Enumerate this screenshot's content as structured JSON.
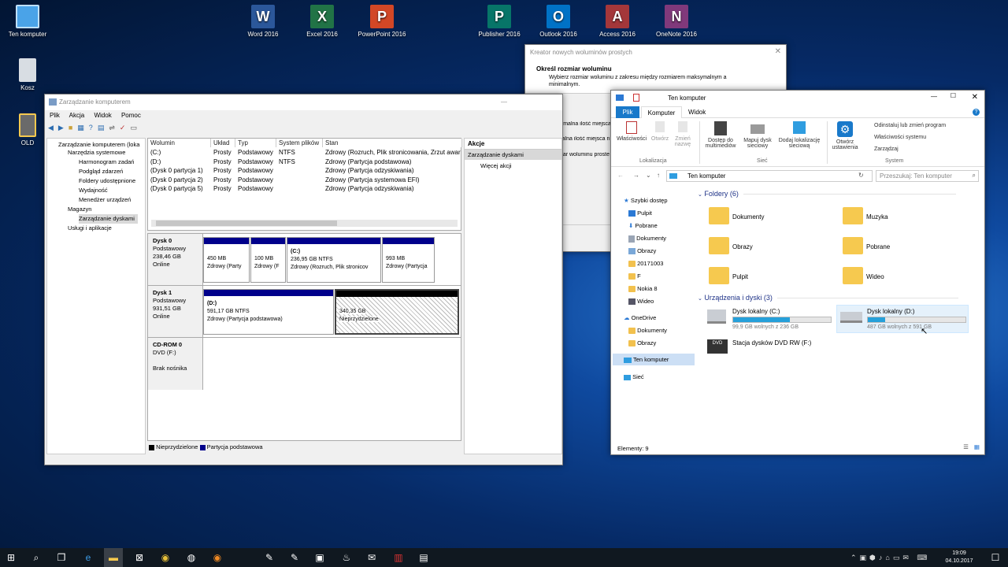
{
  "desktop": {
    "icons": [
      {
        "label": "Ten komputer"
      },
      {
        "label": "Kosz"
      },
      {
        "label": "OLD"
      }
    ],
    "office": [
      {
        "label": "Word 2016",
        "letter": "W",
        "color": "#2b579a"
      },
      {
        "label": "Excel 2016",
        "letter": "X",
        "color": "#217346"
      },
      {
        "label": "PowerPoint 2016",
        "letter": "P",
        "color": "#d24726"
      },
      {
        "label": "Publisher 2016",
        "letter": "P",
        "color": "#077568"
      },
      {
        "label": "Outlook 2016",
        "letter": "O",
        "color": "#0072c6"
      },
      {
        "label": "Access 2016",
        "letter": "A",
        "color": "#a4373a"
      },
      {
        "label": "OneNote 2016",
        "letter": "N",
        "color": "#80397b"
      }
    ]
  },
  "cm": {
    "title": "Zarządzanie komputerem",
    "menu": [
      "Plik",
      "Akcja",
      "Widok",
      "Pomoc"
    ],
    "tree": [
      "Zarządzanie komputerem (loka",
      "Narzędzia systemowe",
      "Harmonogram zadań",
      "Podgląd zdarzeń",
      "Foldery udostępnione",
      "Wydajność",
      "Menedżer urządzeń",
      "Magazyn",
      "Zarządzanie dyskami",
      "Usługi i aplikacje"
    ],
    "columns": [
      "Wolumin",
      "Układ",
      "Typ",
      "System plików",
      "Stan"
    ],
    "volumes": [
      [
        "(C:)",
        "Prosty",
        "Podstawowy",
        "NTFS",
        "Zdrowy (Rozruch, Plik stronicowania, Zrzut awar"
      ],
      [
        "(D:)",
        "Prosty",
        "Podstawowy",
        "NTFS",
        "Zdrowy (Partycja podstawowa)"
      ],
      [
        "(Dysk 0 partycja 1)",
        "Prosty",
        "Podstawowy",
        "",
        "Zdrowy (Partycja odzyskiwania)"
      ],
      [
        "(Dysk 0 partycja 2)",
        "Prosty",
        "Podstawowy",
        "",
        "Zdrowy (Partycja systemowa EFI)"
      ],
      [
        "(Dysk 0 partycja 5)",
        "Prosty",
        "Podstawowy",
        "",
        "Zdrowy (Partycja odzyskiwania)"
      ]
    ],
    "actions_title": "Akcje",
    "actions_sub": "Zarządzanie dyskami",
    "actions_more": "Więcej akcji",
    "disk0": {
      "name": "Dysk 0",
      "type": "Podstawowy",
      "size": "238,46 GB",
      "status": "Online",
      "parts": [
        [
          "450 MB",
          "Zdrowy (Party"
        ],
        [
          "100 MB",
          "Zdrowy (F"
        ],
        [
          "(C:)",
          "236,95 GB NTFS",
          "Zdrowy (Rozruch, Plik stronicov"
        ],
        [
          "993 MB",
          "Zdrowy (Partycja"
        ]
      ]
    },
    "disk1": {
      "name": "Dysk 1",
      "type": "Podstawowy",
      "size": "931,51 GB",
      "status": "Online",
      "d": [
        "(D:)",
        "591,17 GB NTFS",
        "Zdrowy (Partycja podstawowa)"
      ],
      "u": [
        "340,35 GB",
        "Nieprzydzielone"
      ]
    },
    "cdrom": {
      "name": "CD-ROM 0",
      "type": "DVD (F:)",
      "status": "Brak nośnika"
    },
    "legend": [
      "Nieprzydzielone",
      "Partycja podstawowa"
    ]
  },
  "wizard": {
    "title": "Kreator nowych woluminów prostych",
    "heading": "Określ rozmiar woluminu",
    "desc": "Wybierz rozmiar woluminu z zakresu między rozmiarem maksymalnym a minimalnym.",
    "l1": "Maksymalna ilość miejsca",
    "l2": "Minimalna ilość miejsca n",
    "l3": "Rozmiar woluminu proste"
  },
  "explorer": {
    "title": "Ten komputer",
    "tabs": [
      "Plik",
      "Komputer",
      "Widok"
    ],
    "ribbon": {
      "g1": [
        "Właściwości",
        "Otwórz",
        "Zmień nazwę"
      ],
      "g1name": "Lokalizacja",
      "g2": [
        "Dostęp do multimediów",
        "Mapuj dysk sieciowy",
        "Dodaj lokalizację sieciową"
      ],
      "g2name": "Sieć",
      "g3": [
        "Otwórz ustawienia"
      ],
      "g3list": [
        "Odinstaluj lub zmień program",
        "Właściwości systemu",
        "Zarządzaj"
      ],
      "g3name": "System"
    },
    "address": "Ten komputer",
    "search_placeholder": "Przeszukaj: Ten komputer",
    "nav": [
      "Szybki dostęp",
      "Pulpit",
      "Pobrane",
      "Dokumenty",
      "Obrazy",
      "20171003",
      "F",
      "Nokia 8",
      "Wideo",
      "OneDrive",
      "Dokumenty",
      "Obrazy",
      "Ten komputer",
      "Sieć"
    ],
    "folders_header": "Foldery (6)",
    "folders": [
      "Dokumenty",
      "Muzyka",
      "Obrazy",
      "Pobrane",
      "Pulpit",
      "Wideo"
    ],
    "devices_header": "Urządzenia i dyski (3)",
    "c": {
      "name": "Dysk lokalny (C:)",
      "free": "99,9 GB wolnych z 236 GB",
      "used": 0.58
    },
    "d": {
      "name": "Dysk lokalny (D:)",
      "free": "487 GB wolnych z 591 GB",
      "used": 0.18
    },
    "dvd": "Stacja dysków DVD RW (F:)",
    "status": "Elementy: 9"
  },
  "taskbar": {
    "time": "19:09",
    "date": "04.10.2017"
  }
}
